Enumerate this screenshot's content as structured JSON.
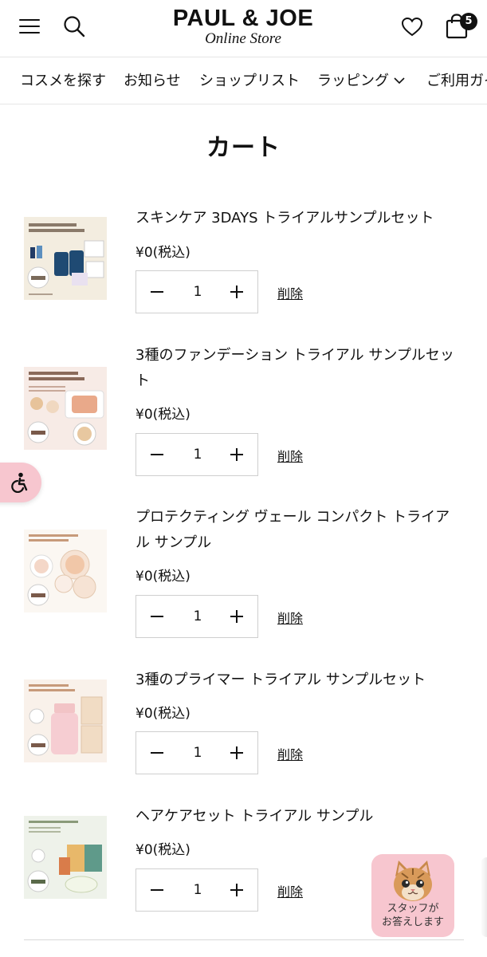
{
  "header": {
    "logo_main": "PAUL & JOE",
    "logo_sub": "Online Store",
    "cart_count": "5"
  },
  "nav": {
    "items": [
      {
        "label": "コスメを探す"
      },
      {
        "label": "お知らせ"
      },
      {
        "label": "ショップリスト"
      },
      {
        "label": "ラッピング"
      },
      {
        "label": "ご利用ガイド"
      }
    ]
  },
  "page": {
    "title": "カート"
  },
  "cart": {
    "delete_label": "削除",
    "items": [
      {
        "name": "スキンケア 3DAYS トライアルサンプルセット",
        "price": "¥0(税込)",
        "quantity": "1"
      },
      {
        "name": "3種のファンデーション トライアル サンプルセット",
        "price": "¥0(税込)",
        "quantity": "1"
      },
      {
        "name": "プロテクティング ヴェール コンパクト トライアル サンプル",
        "price": "¥0(税込)",
        "quantity": "1"
      },
      {
        "name": "3種のプライマー トライアル サンプルセット",
        "price": "¥0(税込)",
        "quantity": "1"
      },
      {
        "name": "ヘアケアセット トライアル サンプル",
        "price": "¥0(税込)",
        "quantity": "1"
      }
    ]
  },
  "chat_widget": {
    "line1": "スタッフが",
    "line2": "お答えします"
  },
  "colors": {
    "accent_pink": "#f7c6cf",
    "text": "#111111",
    "divider": "#e6e6e6"
  }
}
